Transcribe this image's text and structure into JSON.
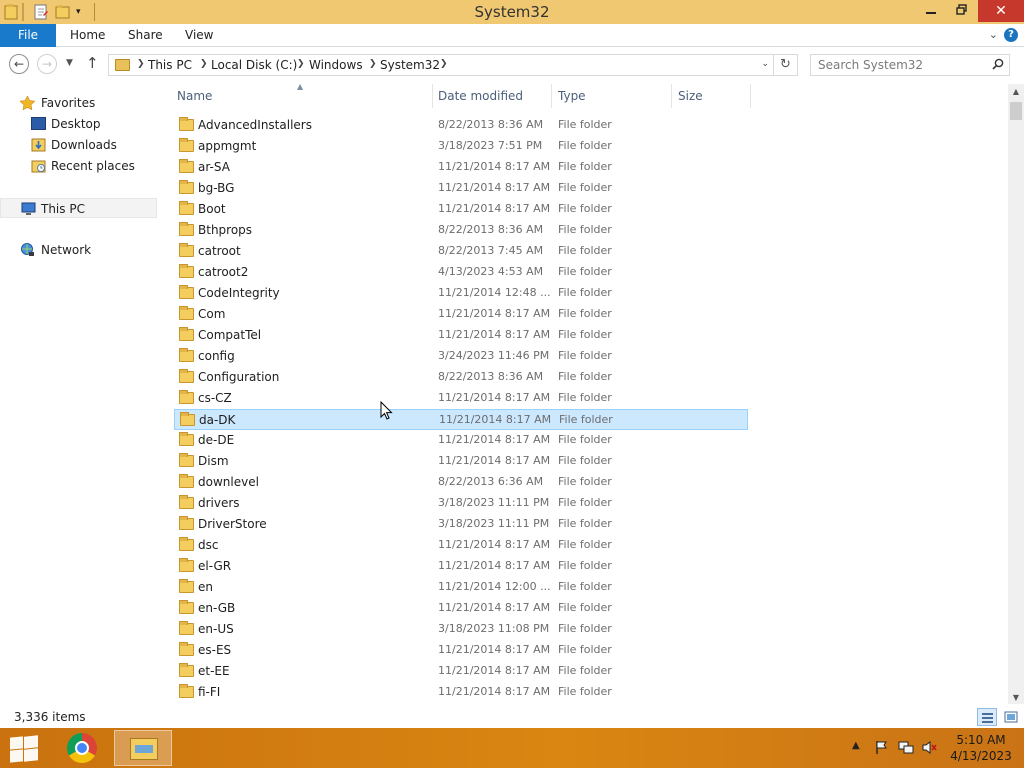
{
  "window": {
    "title": "System32"
  },
  "ribbon": {
    "tabs": [
      "File",
      "Home",
      "Share",
      "View"
    ]
  },
  "address": {
    "breadcrumbs": [
      "This PC",
      "Local Disk (C:)",
      "Windows",
      "System32"
    ],
    "search_placeholder": "Search System32"
  },
  "navpane": {
    "favorites_label": "Favorites",
    "favorites": [
      "Desktop",
      "Downloads",
      "Recent places"
    ],
    "this_pc": "This PC",
    "network": "Network"
  },
  "filelist": {
    "columns": [
      "Name",
      "Date modified",
      "Type",
      "Size"
    ],
    "rows": [
      {
        "name": "AdvancedInstallers",
        "date": "8/22/2013 8:36 AM",
        "type": "File folder"
      },
      {
        "name": "appmgmt",
        "date": "3/18/2023 7:51 PM",
        "type": "File folder"
      },
      {
        "name": "ar-SA",
        "date": "11/21/2014 8:17 AM",
        "type": "File folder"
      },
      {
        "name": "bg-BG",
        "date": "11/21/2014 8:17 AM",
        "type": "File folder"
      },
      {
        "name": "Boot",
        "date": "11/21/2014 8:17 AM",
        "type": "File folder"
      },
      {
        "name": "Bthprops",
        "date": "8/22/2013 8:36 AM",
        "type": "File folder"
      },
      {
        "name": "catroot",
        "date": "8/22/2013 7:45 AM",
        "type": "File folder"
      },
      {
        "name": "catroot2",
        "date": "4/13/2023 4:53 AM",
        "type": "File folder"
      },
      {
        "name": "CodeIntegrity",
        "date": "11/21/2014 12:48 ...",
        "type": "File folder"
      },
      {
        "name": "Com",
        "date": "11/21/2014 8:17 AM",
        "type": "File folder"
      },
      {
        "name": "CompatTel",
        "date": "11/21/2014 8:17 AM",
        "type": "File folder"
      },
      {
        "name": "config",
        "date": "3/24/2023 11:46 PM",
        "type": "File folder"
      },
      {
        "name": "Configuration",
        "date": "8/22/2013 8:36 AM",
        "type": "File folder"
      },
      {
        "name": "cs-CZ",
        "date": "11/21/2014 8:17 AM",
        "type": "File folder"
      },
      {
        "name": "da-DK",
        "date": "11/21/2014 8:17 AM",
        "type": "File folder",
        "selected": true
      },
      {
        "name": "de-DE",
        "date": "11/21/2014 8:17 AM",
        "type": "File folder"
      },
      {
        "name": "Dism",
        "date": "11/21/2014 8:17 AM",
        "type": "File folder"
      },
      {
        "name": "downlevel",
        "date": "8/22/2013 6:36 AM",
        "type": "File folder"
      },
      {
        "name": "drivers",
        "date": "3/18/2023 11:11 PM",
        "type": "File folder"
      },
      {
        "name": "DriverStore",
        "date": "3/18/2023 11:11 PM",
        "type": "File folder"
      },
      {
        "name": "dsc",
        "date": "11/21/2014 8:17 AM",
        "type": "File folder"
      },
      {
        "name": "el-GR",
        "date": "11/21/2014 8:17 AM",
        "type": "File folder"
      },
      {
        "name": "en",
        "date": "11/21/2014 12:00 ...",
        "type": "File folder"
      },
      {
        "name": "en-GB",
        "date": "11/21/2014 8:17 AM",
        "type": "File folder"
      },
      {
        "name": "en-US",
        "date": "3/18/2023 11:08 PM",
        "type": "File folder"
      },
      {
        "name": "es-ES",
        "date": "11/21/2014 8:17 AM",
        "type": "File folder"
      },
      {
        "name": "et-EE",
        "date": "11/21/2014 8:17 AM",
        "type": "File folder"
      },
      {
        "name": "fi-FI",
        "date": "11/21/2014 8:17 AM",
        "type": "File folder"
      }
    ]
  },
  "status": {
    "item_count": "3,336 items"
  },
  "taskbar": {
    "apps": [
      "chrome-icon",
      "file-explorer-icon"
    ],
    "time": "5:10 AM",
    "date": "4/13/2023"
  },
  "colors": {
    "titlebar": "#f0c871",
    "file_tab": "#1979ca",
    "selection_bg": "#cce8ff",
    "selection_border": "#99d1ff",
    "taskbar": "#d98612",
    "close_button": "#c7382c"
  }
}
